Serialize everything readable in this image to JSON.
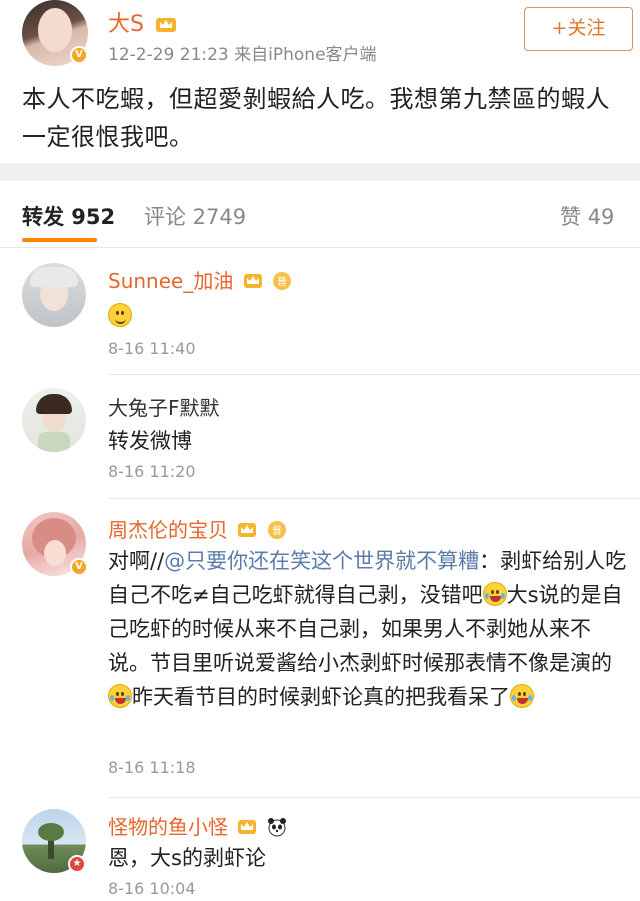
{
  "post": {
    "author": "大S",
    "meta": "12-2-29 21:23  来自iPhone客户端",
    "follow_label": "+关注",
    "text": "本人不吃蝦，但超愛剝蝦給人吃。我想第九禁區的蝦人一定很恨我吧。"
  },
  "tabs": [
    {
      "label": "转发 952"
    },
    {
      "label": "评论 2749"
    },
    {
      "label": "赞 49"
    }
  ],
  "comments": [
    {
      "name": "Sunnee_加油",
      "text": "",
      "time": "8-16 11:40"
    },
    {
      "name": "大兔子F默默",
      "text": "转发微博",
      "time": "8-16 11:20"
    },
    {
      "name": "周杰伦的宝贝",
      "text_prefix": "对啊//",
      "mention": "@只要你还在笑这个世界就不算糟",
      "text_1": "：剥虾给别人吃自己不吃≠自己吃虾就得自己剥，没错吧",
      "text_2": "大s说的是自己吃虾的时候从来不自己剥，如果男人不剥她从来不说。节目里听说爱酱给小杰剥虾时候那表情不像是演的",
      "text_3": "昨天看节目的时候剥虾论真的把我看呆了",
      "time": "8-16 11:18"
    },
    {
      "name": "怪物的鱼小怪",
      "text": "恩，大s的剥虾论",
      "time": "8-16 10:04"
    }
  ],
  "colors": {
    "accent": "#ff8200",
    "name_orange": "#e8662b",
    "mention": "#5b7cab"
  }
}
